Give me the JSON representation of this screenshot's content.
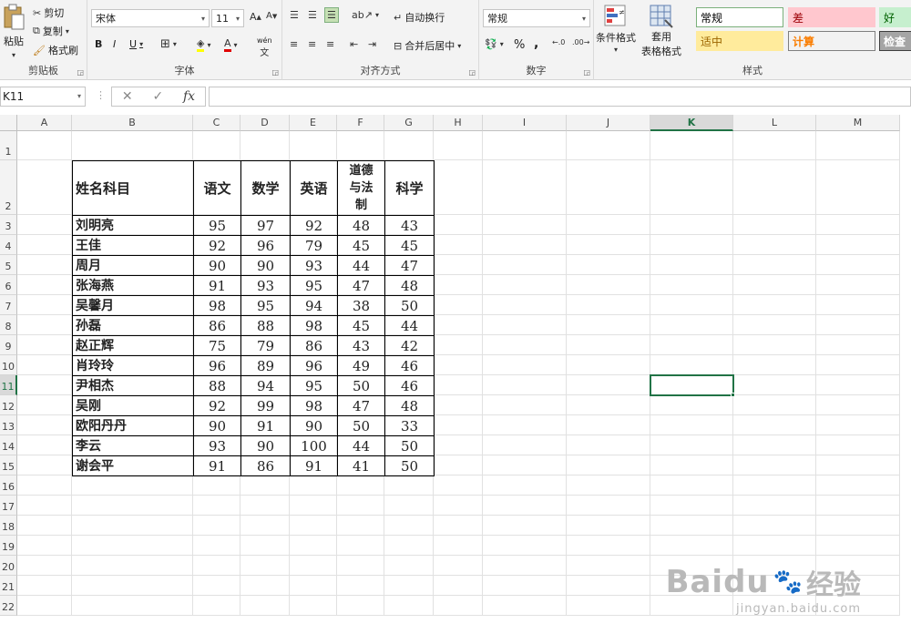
{
  "ribbon": {
    "clipboard": {
      "paste": "粘贴",
      "cut": "剪切",
      "copy": "复制",
      "format_painter": "格式刷",
      "label": "剪贴板"
    },
    "font": {
      "name": "宋体",
      "size": "11",
      "bold": "B",
      "italic": "I",
      "underline": "U",
      "label": "字体",
      "wen": "wén"
    },
    "alignment": {
      "wrap": "自动换行",
      "merge": "合并后居中",
      "label": "对齐方式"
    },
    "number": {
      "format": "常规",
      "percent": "%",
      "comma": ",",
      "label": "数字"
    },
    "styles": {
      "cond_format": "条件格式",
      "table_format_1": "套用",
      "table_format_2": "表格格式",
      "label": "样式",
      "cells": [
        {
          "name": "常规",
          "color": "#000000",
          "bg": "#ffffff",
          "border": "#7bb07b"
        },
        {
          "name": "差",
          "color": "#9c0006",
          "bg": "#ffc7ce",
          "border": "#ffc7ce"
        },
        {
          "name": "好",
          "color": "#006100",
          "bg": "#c6efce",
          "border": "#c6efce"
        },
        {
          "name": "适中",
          "color": "#9c6500",
          "bg": "#ffeb9c",
          "border": "#ffeb9c"
        },
        {
          "name": "计算",
          "color": "#fa7d00",
          "bg": "#f2f2f2",
          "border": "#7f7f7f"
        },
        {
          "name": "检查",
          "color": "#ffffff",
          "bg": "#a5a5a5",
          "border": "#3f3f3f"
        }
      ]
    }
  },
  "formula_bar": {
    "name_box": "K11",
    "fx": "fx",
    "value": ""
  },
  "columns": [
    "A",
    "B",
    "C",
    "D",
    "E",
    "F",
    "G",
    "H",
    "I",
    "J",
    "K",
    "L",
    "M"
  ],
  "selected_column": "K",
  "rows": [
    "1",
    "2",
    "3",
    "4",
    "5",
    "6",
    "7",
    "8",
    "9",
    "10",
    "11",
    "12",
    "13",
    "14",
    "15",
    "16",
    "17",
    "18",
    "19",
    "20",
    "21",
    "22"
  ],
  "selected_row": "11",
  "table": {
    "headers": [
      "姓名科目",
      "语文",
      "数学",
      "英语",
      "道德与法制",
      "科学"
    ],
    "header_wrapped": [
      "道德",
      "与法",
      "制"
    ],
    "rows": [
      [
        "刘明亮",
        "95",
        "97",
        "92",
        "48",
        "43"
      ],
      [
        "王佳",
        "92",
        "96",
        "79",
        "45",
        "45"
      ],
      [
        "周月",
        "90",
        "90",
        "93",
        "44",
        "47"
      ],
      [
        "张海燕",
        "91",
        "93",
        "95",
        "47",
        "48"
      ],
      [
        "吴馨月",
        "98",
        "95",
        "94",
        "38",
        "50"
      ],
      [
        "孙磊",
        "86",
        "88",
        "98",
        "45",
        "44"
      ],
      [
        "赵正辉",
        "75",
        "79",
        "86",
        "43",
        "42"
      ],
      [
        "肖玲玲",
        "96",
        "89",
        "96",
        "49",
        "46"
      ],
      [
        "尹相杰",
        "88",
        "94",
        "95",
        "50",
        "46"
      ],
      [
        "吴刚",
        "92",
        "99",
        "98",
        "47",
        "48"
      ],
      [
        "欧阳丹丹",
        "90",
        "91",
        "90",
        "50",
        "33"
      ],
      [
        "李云",
        "93",
        "90",
        "100",
        "44",
        "50"
      ],
      [
        "谢会平",
        "91",
        "86",
        "91",
        "41",
        "50"
      ]
    ]
  },
  "watermark": {
    "brand": "Baidu",
    "brand_cn": "经验",
    "url": "jingyan.baidu.com"
  },
  "accent": "#217346"
}
